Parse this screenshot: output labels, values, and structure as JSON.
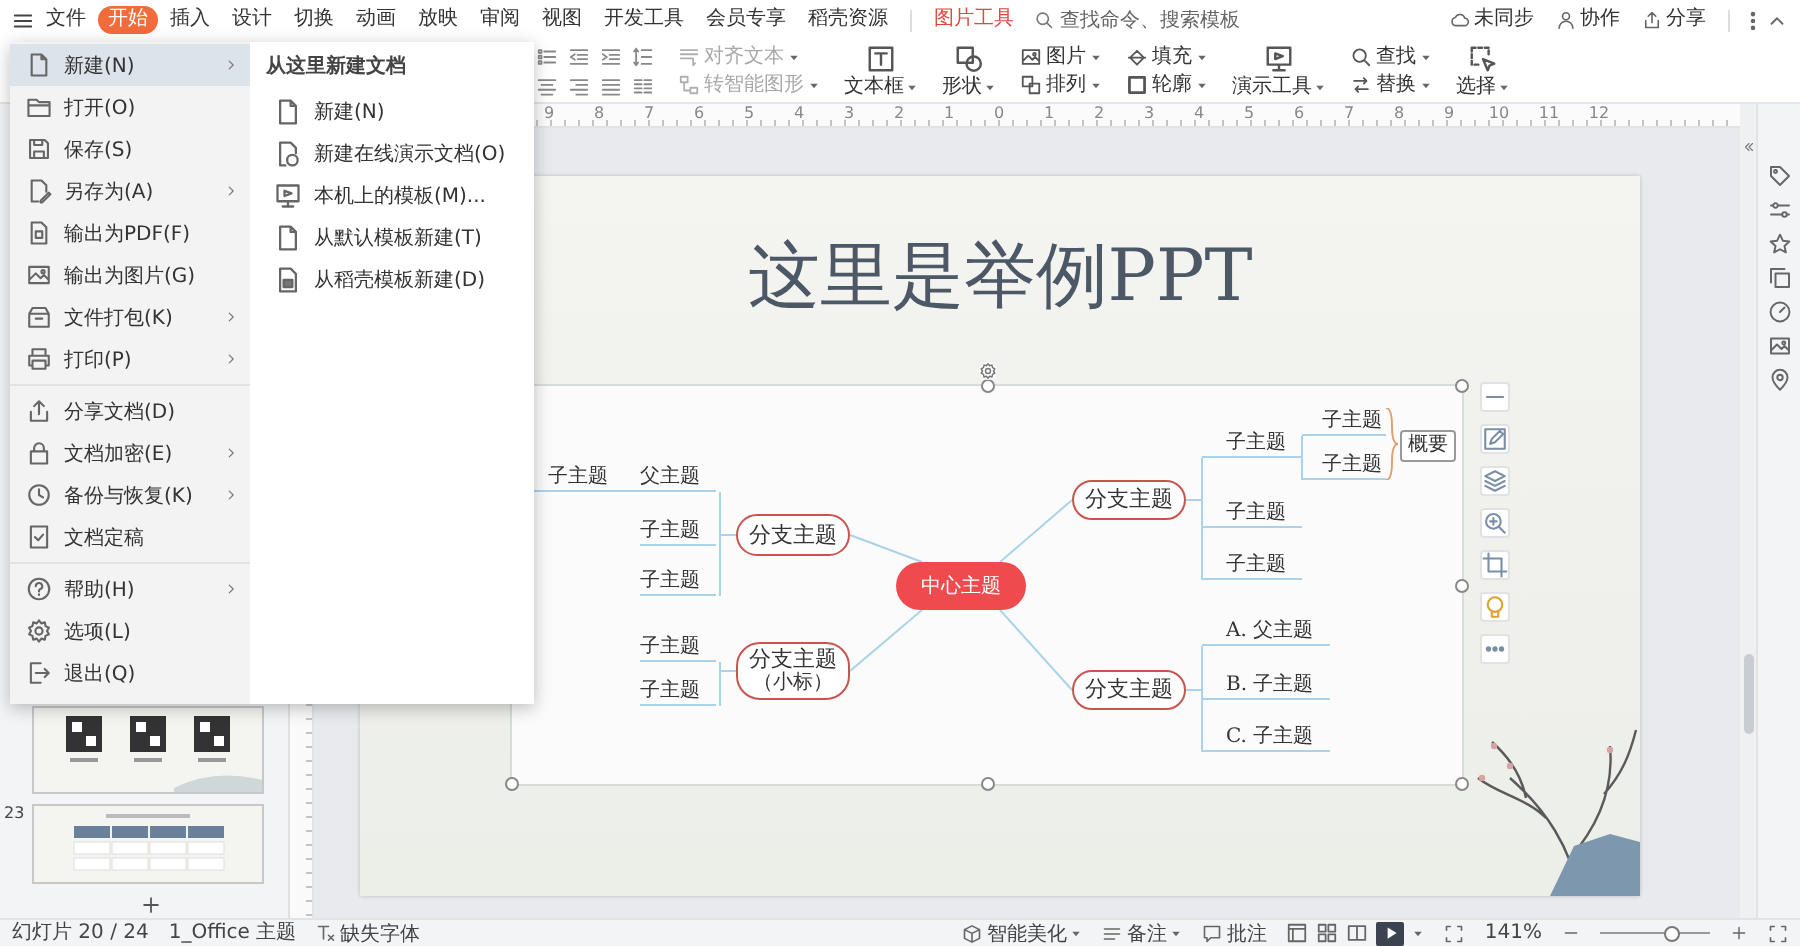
{
  "menu_bar": {
    "tabs": [
      {
        "label": "文件",
        "selected": false
      },
      {
        "label": "开始",
        "selected": true
      },
      {
        "label": "插入",
        "selected": false
      },
      {
        "label": "设计",
        "selected": false
      },
      {
        "label": "切换",
        "selected": false
      },
      {
        "label": "动画",
        "selected": false
      },
      {
        "label": "放映",
        "selected": false
      },
      {
        "label": "审阅",
        "selected": false
      },
      {
        "label": "视图",
        "selected": false
      },
      {
        "label": "开发工具",
        "selected": false
      },
      {
        "label": "会员专享",
        "selected": false
      },
      {
        "label": "稻壳资源",
        "selected": false
      }
    ],
    "context_tab": {
      "label": "图片工具"
    },
    "search": {
      "placeholder": "查找命令、搜索模板"
    },
    "actions": [
      {
        "label": "未同步"
      },
      {
        "label": "协作"
      },
      {
        "label": "分享"
      }
    ]
  },
  "ribbon": {
    "groups": [
      {
        "kind": "stack",
        "items": [
          {
            "label": "对齐文本",
            "disabled": true
          },
          {
            "label": "转智能图形",
            "disabled": true
          }
        ]
      },
      {
        "kind": "large",
        "items": [
          {
            "label": "文本框",
            "disabled": false
          }
        ]
      },
      {
        "kind": "large",
        "items": [
          {
            "label": "形状",
            "disabled": false
          }
        ]
      },
      {
        "kind": "stack",
        "items": [
          {
            "label": "图片",
            "disabled": false
          },
          {
            "label": "排列",
            "disabled": false
          }
        ]
      },
      {
        "kind": "stack",
        "items": [
          {
            "label": "填充",
            "disabled": false
          },
          {
            "label": "轮廓",
            "disabled": false
          }
        ]
      },
      {
        "kind": "large",
        "items": [
          {
            "label": "演示工具",
            "disabled": false
          }
        ]
      },
      {
        "kind": "stack",
        "items": [
          {
            "label": "查找",
            "disabled": false
          },
          {
            "label": "替换",
            "disabled": false
          }
        ]
      },
      {
        "kind": "large",
        "items": [
          {
            "label": "选择",
            "disabled": false
          }
        ]
      }
    ]
  },
  "file_menu": {
    "sections": [
      {
        "items": [
          {
            "label": "新建(N)",
            "has_submenu": true,
            "selected": true
          },
          {
            "label": "打开(O)",
            "has_submenu": false,
            "selected": false
          },
          {
            "label": "保存(S)",
            "has_submenu": false,
            "selected": false
          },
          {
            "label": "另存为(A)",
            "has_submenu": true,
            "selected": false
          },
          {
            "label": "输出为PDF(F)",
            "has_submenu": false,
            "selected": false
          },
          {
            "label": "输出为图片(G)",
            "has_submenu": false,
            "selected": false
          },
          {
            "label": "文件打包(K)",
            "has_submenu": true,
            "selected": false
          },
          {
            "label": "打印(P)",
            "has_submenu": true,
            "selected": false
          }
        ]
      },
      {
        "items": [
          {
            "label": "分享文档(D)",
            "has_submenu": false,
            "selected": false
          },
          {
            "label": "文档加密(E)",
            "has_submenu": true,
            "selected": false
          },
          {
            "label": "备份与恢复(K)",
            "has_submenu": true,
            "selected": false
          },
          {
            "label": "文档定稿",
            "has_submenu": false,
            "selected": false
          }
        ]
      },
      {
        "items": [
          {
            "label": "帮助(H)",
            "has_submenu": true,
            "selected": false
          },
          {
            "label": "选项(L)",
            "has_submenu": false,
            "selected": false
          },
          {
            "label": "退出(Q)",
            "has_submenu": false,
            "selected": false
          }
        ]
      }
    ],
    "submenu": {
      "title": "从这里新建文档",
      "items": [
        {
          "label": "新建(N)"
        },
        {
          "label": "新建在线演示文档(O)"
        },
        {
          "label": "本机上的模板(M)..."
        },
        {
          "label": "从默认模板新建(T)"
        },
        {
          "label": "从稻壳模板新建(D)"
        }
      ]
    }
  },
  "ruler": {
    "labels": [
      "9",
      "8",
      "7",
      "6",
      "5",
      "4",
      "3",
      "2",
      "1",
      "0",
      "1",
      "2",
      "3",
      "4",
      "5",
      "6",
      "7",
      "8",
      "9",
      "10",
      "11",
      "12"
    ]
  },
  "slides_panel": {
    "thumbnails": [
      {
        "kind": "qr-codes"
      },
      {
        "kind": "table",
        "number": "23"
      }
    ]
  },
  "slide": {
    "title": "这里是举例PPT",
    "mindmap": {
      "center": "中心主题",
      "branches": [
        {
          "label": "分支主题",
          "children": [
            {
              "label": "父主题",
              "children": [
                {
                  "label": "子主题"
                }
              ]
            },
            {
              "label": "子主题"
            },
            {
              "label": "子主题"
            }
          ]
        },
        {
          "label": "分支主题",
          "note": "（小标）",
          "children": [
            {
              "label": "子主题"
            },
            {
              "label": "子主题"
            }
          ]
        },
        {
          "label": "分支主题",
          "children": [
            {
              "label": "子主题",
              "children": [
                {
                  "label": "子主题"
                },
                {
                  "label": "子主题"
                }
              ],
              "summary": "概要"
            },
            {
              "label": "子主题"
            },
            {
              "label": "子主题"
            }
          ]
        },
        {
          "label": "分支主题",
          "children": [
            {
              "label": "A. 父主题"
            },
            {
              "label": "B. 子主题"
            },
            {
              "label": "C. 子主题"
            }
          ]
        }
      ]
    }
  },
  "status_bar": {
    "slide_position": "幻灯片 20 / 24",
    "theme": "1_Office 主题",
    "missing_fonts": "缺失字体",
    "smart_beautify": "智能美化",
    "notes": "备注",
    "comments": "批注",
    "zoom": {
      "reading": "141%",
      "level": 0.65
    }
  }
}
